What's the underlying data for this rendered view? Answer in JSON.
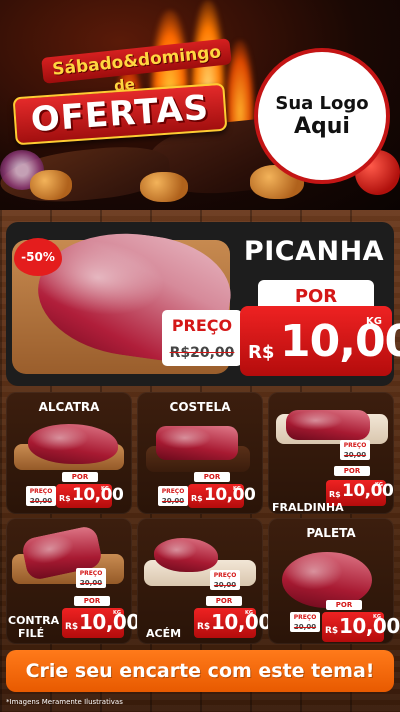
{
  "header": {
    "promo_line1": "Sábado&domingo",
    "promo_line2": "de",
    "promo_main": "OFERTAS",
    "logo_line1": "Sua Logo",
    "logo_line2": "Aqui"
  },
  "hero": {
    "discount": "-50%",
    "name": "PICANHA",
    "por_label": "POR",
    "preco_label": "PREÇO",
    "old_price": "R$20,00",
    "currency": "R$",
    "new_price": "10,00",
    "unit": "KG"
  },
  "products": [
    {
      "name": "ALCATRA",
      "preco_label": "PREÇO",
      "old_price": "20,00",
      "por_label": "POR",
      "currency": "R$",
      "price": "10,00",
      "unit": "KG"
    },
    {
      "name": "COSTELA",
      "preco_label": "PREÇO",
      "old_price": "20,00",
      "por_label": "POR",
      "currency": "R$",
      "price": "10,00",
      "unit": "KG"
    },
    {
      "name": "FRALDINHA",
      "preco_label": "PREÇO",
      "old_price": "20,00",
      "por_label": "POR",
      "currency": "R$",
      "price": "10,00",
      "unit": "KG"
    },
    {
      "name_line1": "CONTRA",
      "name_line2": "FILÉ",
      "preco_label": "PREÇO",
      "old_price": "20,00",
      "por_label": "POR",
      "currency": "R$",
      "price": "10,00",
      "unit": "KG"
    },
    {
      "name": "ACÉM",
      "preco_label": "PREÇO",
      "old_price": "20,00",
      "por_label": "POR",
      "currency": "R$",
      "price": "10,00",
      "unit": "KG"
    },
    {
      "name": "PALETA",
      "preco_label": "PREÇO",
      "old_price": "20,00",
      "por_label": "POR",
      "currency": "R$",
      "price": "10,00",
      "unit": "KG"
    }
  ],
  "footer": {
    "cta": "Crie seu encarte com este tema!",
    "disclaimer": "*Imagens Meramente Ilustrativas"
  }
}
